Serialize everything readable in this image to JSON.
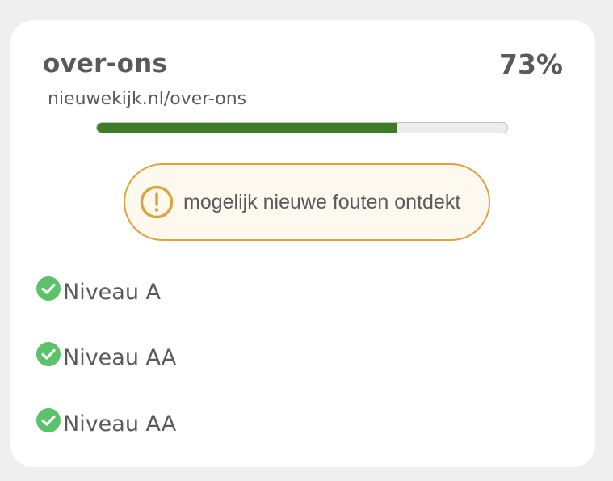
{
  "page": {
    "title": "over-ons",
    "url": "nieuwekijk.nl/over-ons",
    "score_label": "73%",
    "progress": 0.73
  },
  "warning": {
    "text": "mogelijk nieuwe fouten ontdekt",
    "icon": "exclamation-circle-icon",
    "color": "#e0a23f"
  },
  "levels": [
    {
      "label": "Niveau A",
      "status": "passed",
      "icon": "check-circle-icon"
    },
    {
      "label": "Niveau AA",
      "status": "passed",
      "icon": "check-circle-icon"
    },
    {
      "label": "Niveau AA",
      "status": "passed",
      "icon": "check-circle-icon"
    }
  ],
  "colors": {
    "progress_fill": "#3e7b27",
    "check": "#5cc26a",
    "text": "#585a5e"
  }
}
